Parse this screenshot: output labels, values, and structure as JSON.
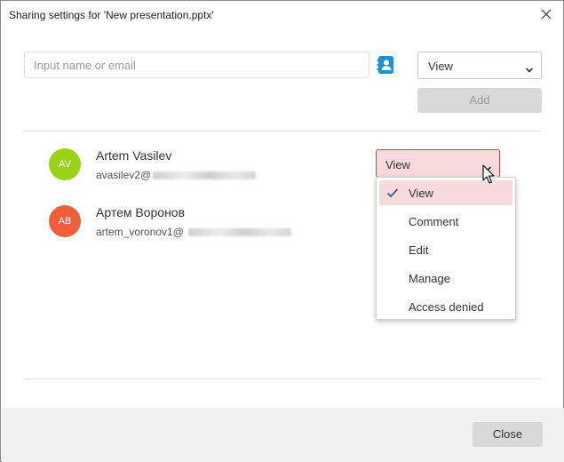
{
  "window": {
    "title": "Sharing settings for 'New presentation.pptx'"
  },
  "invite": {
    "placeholder": "Input name or email",
    "role_value": "View",
    "add_label": "Add"
  },
  "users": [
    {
      "initials": "AV",
      "name": "Artem Vasilev",
      "email_prefix": "avasilev2@",
      "avatar_color": "#9bd219",
      "role": "View"
    },
    {
      "initials": "AB",
      "name": "Артем Воронов",
      "email_prefix": "artem_voronov1@",
      "avatar_color": "#f05e3c"
    }
  ],
  "role_menu": {
    "options": [
      "View",
      "Comment",
      "Edit",
      "Manage",
      "Access denied"
    ],
    "selected": "View"
  },
  "footer": {
    "close_label": "Close"
  },
  "colors": {
    "accent": "#c4464b",
    "accent_bg": "#f7dadb",
    "contacts_icon": "#1e90d6",
    "check": "#3a5a80"
  },
  "icons": {
    "close": "close-icon",
    "contacts": "address-book-icon",
    "chevron": "chevron-down-icon",
    "check": "checkmark-icon",
    "cursor": "mouse-pointer-icon"
  }
}
